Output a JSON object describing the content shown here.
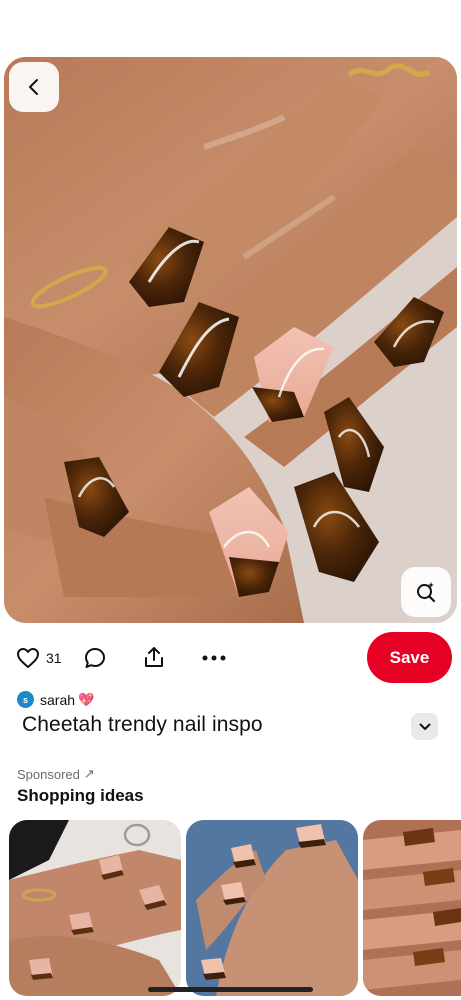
{
  "pin": {
    "like_count": "31",
    "save_label": "Save",
    "creator_initial": "s",
    "creator_name": "sarah",
    "creator_emoji": "💖",
    "title": "Cheetah trendy nail inspo"
  },
  "shopping": {
    "sponsored_label": "Sponsored",
    "sponsored_arrow": "↗",
    "title": "Shopping ideas"
  },
  "colors": {
    "save_button": "#e60023",
    "avatar": "#1b89c9"
  },
  "icons": {
    "back": "chevron-left-icon",
    "lens": "visual-search-icon",
    "like": "heart-icon",
    "comment": "comment-icon",
    "share": "share-icon",
    "more": "more-dots-icon",
    "expand": "chevron-down-icon"
  }
}
